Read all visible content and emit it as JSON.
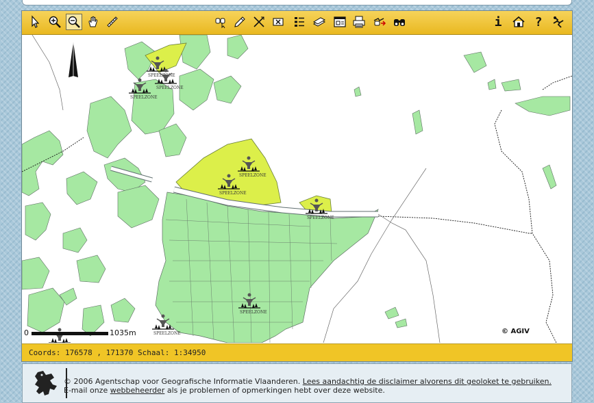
{
  "toolbar": {
    "left_tools": [
      {
        "name": "identify-icon",
        "active": false
      },
      {
        "name": "zoom-in-icon",
        "active": false
      },
      {
        "name": "zoom-out-icon",
        "active": true
      },
      {
        "name": "pan-hand-icon",
        "active": false
      },
      {
        "name": "measure-ruler-icon",
        "active": false
      }
    ],
    "center_tools": [
      "search-binoculars-pointer-icon",
      "pencil-icon",
      "erase-icon",
      "clear-selection-icon",
      "legend-icon",
      "layers-icon",
      "window-overview-icon",
      "print-icon",
      "export-icon",
      "binoculars-icon"
    ],
    "right_tools": [
      "info-icon",
      "home-icon",
      "help-icon",
      "exit-icon"
    ],
    "info_label": "i",
    "help_label": "?"
  },
  "map": {
    "north_arrow": "north-arrow-icon",
    "scalebar": {
      "start_label": "0",
      "end_label": "1035m"
    },
    "copyright": "© AGIV",
    "marker_label": "SPEELZONE",
    "colors": {
      "parcel": "#a6e8a2",
      "highlight": "#dcef4a",
      "line": "#5f6e6f"
    }
  },
  "status": {
    "coords_label": "Coords:",
    "x": "176578",
    "y": "171370",
    "scale_label": "Schaal:",
    "scale_value": "1:34950"
  },
  "footer": {
    "copyright_text": "© 2006 Agentschap voor Geografische Informatie Vlaanderen.",
    "disclaimer_link": "Lees aandachtig de disclaimer alvorens dit geoloket te gebruiken.",
    "email_prefix": "E-mail onze",
    "webmaster_link": "webbeheerder",
    "email_suffix": "als je problemen of opmerkingen hebt over deze website."
  }
}
